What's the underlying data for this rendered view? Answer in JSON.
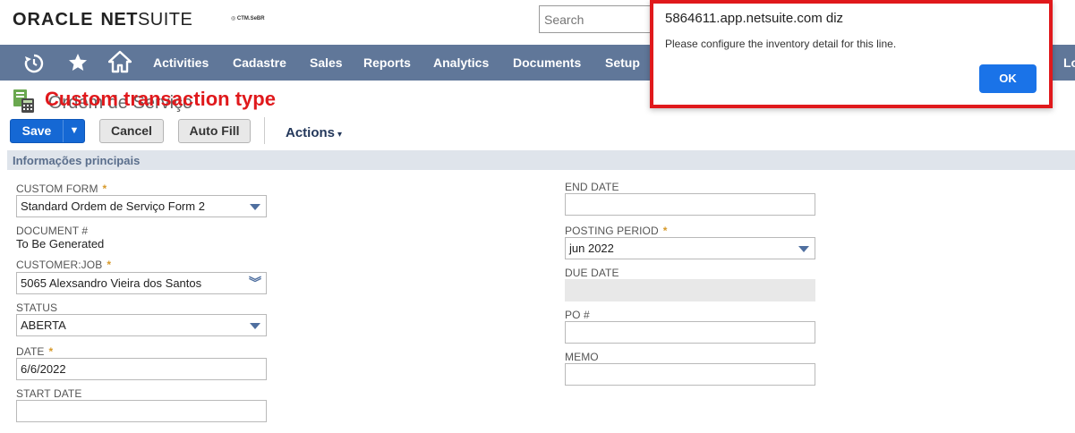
{
  "header": {
    "logo_oracle": "ORACLE",
    "logo_net": "NET",
    "logo_suite": "SUITE",
    "sublogo": "◎ CTM.SeBR",
    "search_placeholder": "Search"
  },
  "nav": {
    "icons": [
      "recent-icon",
      "star-icon",
      "home-icon"
    ],
    "items": [
      "Activities",
      "Cadastre",
      "Sales",
      "Reports",
      "Analytics",
      "Documents",
      "Setup"
    ],
    "edge_text": "Lo"
  },
  "page": {
    "title_ghost": "Ordem de Serviço",
    "title_overlay": "Custom transaction type"
  },
  "toolbar": {
    "save_label": "Save",
    "save_arrow": "▼",
    "cancel_label": "Cancel",
    "autofill_label": "Auto Fill",
    "actions_label": "Actions",
    "actions_caret": "▾"
  },
  "section": {
    "title": "Informações principais"
  },
  "fields": {
    "custom_form": {
      "label": "CUSTOM FORM",
      "required": "*",
      "value": "Standard Ordem de Serviço Form 2"
    },
    "document_no": {
      "label": "DOCUMENT #",
      "value": "To Be Generated"
    },
    "customer_job": {
      "label": "CUSTOMER:JOB",
      "required": "*",
      "value": "5065 Alexsandro Vieira dos Santos",
      "icon": "double-chevron-icon",
      "icon_glyph": "︾"
    },
    "status": {
      "label": "STATUS",
      "value": "ABERTA"
    },
    "date": {
      "label": "DATE",
      "required": "*",
      "value": "6/6/2022"
    },
    "start_date": {
      "label": "START DATE",
      "value": ""
    },
    "end_date": {
      "label": "END DATE",
      "value": ""
    },
    "posting_period": {
      "label": "POSTING PERIOD",
      "required": "*",
      "value": "jun 2022"
    },
    "due_date": {
      "label": "DUE DATE",
      "value": ""
    },
    "po_no": {
      "label": "PO #",
      "value": ""
    },
    "memo": {
      "label": "MEMO",
      "value": ""
    }
  },
  "dialog": {
    "host": "5864611.app.netsuite.com diz",
    "message": "Please configure the inventory detail for this line.",
    "ok_label": "OK"
  },
  "colors": {
    "nav_bg": "#607799",
    "primary_button": "#1568d4",
    "dialog_border": "#e0191c",
    "overlay_text": "#e0191c",
    "required_marker": "#d79a2b"
  }
}
